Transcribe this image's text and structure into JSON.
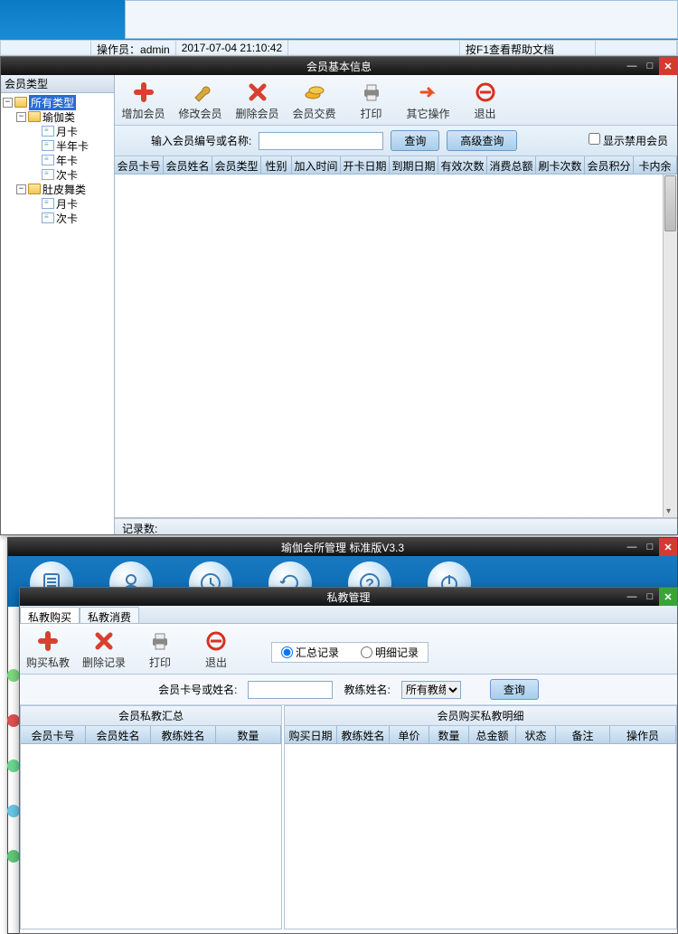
{
  "statusbar": {
    "operator_label": "操作员：",
    "operator_value": "admin",
    "datetime": "2017-07-04 21:10:42",
    "help_hint": "按F1查看帮助文档"
  },
  "dlg1": {
    "title": "会员基本信息",
    "tree_header": "会员类型",
    "tree": {
      "root": "所有类型",
      "cat1": "瑜伽类",
      "cat1_items": [
        "月卡",
        "半年卡",
        "年卡",
        "次卡"
      ],
      "cat2": "肚皮舞类",
      "cat2_items": [
        "月卡",
        "次卡"
      ]
    },
    "tools": [
      "增加会员",
      "修改会员",
      "删除会员",
      "会员交费",
      "打印",
      "其它操作",
      "退出"
    ],
    "search": {
      "label": "输入会员编号或名称:",
      "btn_query": "查询",
      "btn_adv": "高级查询",
      "cb_disabled": "显示禁用会员"
    },
    "grid_cols": [
      "会员卡号",
      "会员姓名",
      "会员类型",
      "性别",
      "加入时间",
      "开卡日期",
      "到期日期",
      "有效次数",
      "消费总额",
      "刷卡次数",
      "会员积分",
      "卡内余额"
    ],
    "footer_label": "记录数:"
  },
  "dlg2": {
    "title": "瑜伽会所管理 标准版V3.3"
  },
  "dlg3": {
    "title": "私教管理",
    "tabs": [
      "私教购买",
      "私教消费"
    ],
    "tools": [
      "购买私教",
      "删除记录",
      "打印",
      "退出"
    ],
    "radios": [
      "汇总记录",
      "明细记录"
    ],
    "search": {
      "label_card": "会员卡号或姓名:",
      "label_coach": "教练姓名:",
      "coach_opt": "所有教练",
      "btn_query": "查询"
    },
    "pane_l_title": "会员私教汇总",
    "pane_l_cols": [
      "会员卡号",
      "会员姓名",
      "教练姓名",
      "数量"
    ],
    "pane_r_title": "会员购买私教明细",
    "pane_r_cols": [
      "购买日期",
      "教练姓名",
      "单价",
      "数量",
      "总金额",
      "状态",
      "备注",
      "操作员"
    ]
  }
}
